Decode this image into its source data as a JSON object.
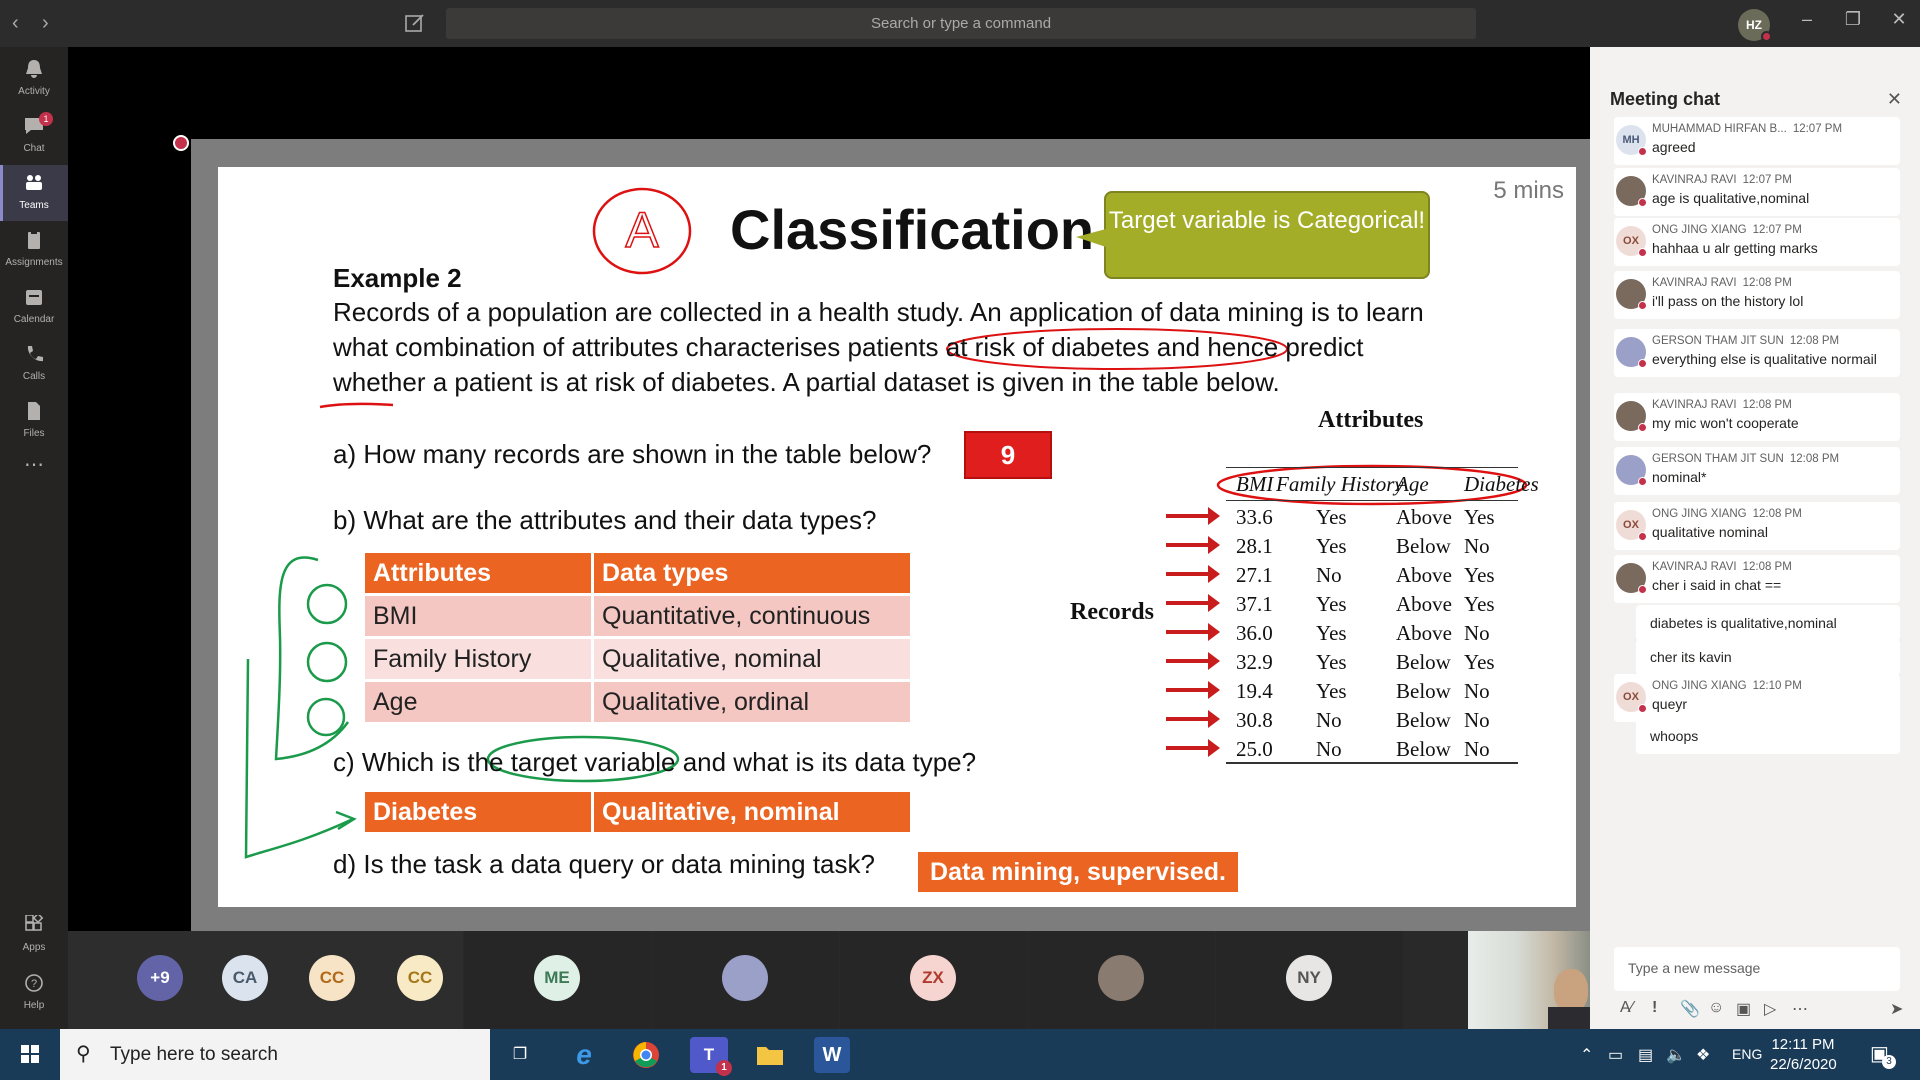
{
  "titlebar": {
    "search_placeholder": "Search or type a command",
    "user_initials": "HZ"
  },
  "rail": {
    "items": [
      {
        "label": "Activity",
        "icon": "bell-icon"
      },
      {
        "label": "Chat",
        "icon": "chat-icon",
        "badge": "1"
      },
      {
        "label": "Teams",
        "icon": "teams-icon",
        "active": true
      },
      {
        "label": "Assignments",
        "icon": "assignments-icon"
      },
      {
        "label": "Calendar",
        "icon": "calendar-icon"
      },
      {
        "label": "Calls",
        "icon": "phone-icon"
      },
      {
        "label": "Files",
        "icon": "files-icon"
      },
      {
        "label": "Apps",
        "icon": "apps-icon"
      },
      {
        "label": "Help",
        "icon": "help-icon"
      }
    ]
  },
  "slide": {
    "title": "Classification",
    "title_mark": "A",
    "timer": "5 mins",
    "callout": "Target variable is Categorical!",
    "example": "Example 2",
    "paragraph": "Records of a population are collected in a health study. An application of data mining is to learn what combination of attributes characterises patients at risk of diabetes and hence predict whether a patient is at risk of diabetes. A partial dataset is given in the table below.",
    "q_a": "a) How many records are shown in the table below?",
    "q_a_answer": "9",
    "q_b": "b) What are the attributes and their data types?",
    "types_table": {
      "headers": [
        "Attributes",
        "Data types"
      ],
      "rows": [
        [
          "BMI",
          "Quantitative, continuous"
        ],
        [
          "Family History",
          "Qualitative, nominal"
        ],
        [
          "Age",
          "Qualitative, ordinal"
        ]
      ]
    },
    "q_c": "c) Which is the target variable and what is its data type?",
    "target_row": [
      "Diabetes",
      "Qualitative, nominal"
    ],
    "q_d": "d) Is the task a data query or data mining task?",
    "q_d_answer": "Data mining, supervised.",
    "attributes_caption": "Attributes",
    "records_label": "Records",
    "records_table": {
      "headers": [
        "BMI",
        "Family History",
        "Age",
        "Diabetes"
      ],
      "rows": [
        [
          "33.6",
          "Yes",
          "Above",
          "Yes"
        ],
        [
          "28.1",
          "Yes",
          "Below",
          "No"
        ],
        [
          "27.1",
          "No",
          "Above",
          "Yes"
        ],
        [
          "37.1",
          "Yes",
          "Above",
          "Yes"
        ],
        [
          "36.0",
          "Yes",
          "Above",
          "No"
        ],
        [
          "32.9",
          "Yes",
          "Below",
          "Yes"
        ],
        [
          "19.4",
          "Yes",
          "Below",
          "No"
        ],
        [
          "30.8",
          "No",
          "Below",
          "No"
        ],
        [
          "25.0",
          "No",
          "Below",
          "No"
        ]
      ]
    }
  },
  "participants": [
    {
      "initials": "+9",
      "bg": "#6264a7",
      "fg": "#ffffff"
    },
    {
      "initials": "CA",
      "bg": "#dbe4ee",
      "fg": "#4a5a6a"
    },
    {
      "initials": "CC",
      "bg": "#f7e4c6",
      "fg": "#b06a1a"
    },
    {
      "initials": "CC",
      "bg": "#f7eac4",
      "fg": "#a4781a"
    },
    {
      "initials": "ME",
      "bg": "#dff0e6",
      "fg": "#3d7a56"
    },
    {
      "initials": "",
      "bg": "#9aa0c8",
      "fg": "#ffffff"
    },
    {
      "initials": "ZX",
      "bg": "#f6d5d0",
      "fg": "#b03a2e"
    },
    {
      "initials": "",
      "bg": "#8a7b70",
      "fg": "#ffffff"
    },
    {
      "initials": "NY",
      "bg": "#e7e6e5",
      "fg": "#555555"
    }
  ],
  "chat": {
    "title": "Meeting chat",
    "compose_placeholder": "Type a new message",
    "messages": [
      {
        "initials": "MH",
        "name": "MUHAMMAD HIRFAN B...",
        "time": "12:07 PM",
        "text": "agreed",
        "avbg": "#dde3ee",
        "avfg": "#4a5a7a"
      },
      {
        "initials": "",
        "name": "KAVINRAJ RAVI",
        "time": "12:07 PM",
        "text": "age is qualitative,nominal",
        "avbg": "#7a6a5e",
        "avfg": "#fff"
      },
      {
        "initials": "OX",
        "name": "ONG JING XIANG",
        "time": "12:07 PM",
        "text": "hahhaa u alr getting marks",
        "avbg": "#f0dcd6",
        "avfg": "#8a4a3a"
      },
      {
        "initials": "",
        "name": "KAVINRAJ RAVI",
        "time": "12:08 PM",
        "text": "i'll pass on the history lol",
        "avbg": "#7a6a5e",
        "avfg": "#fff"
      },
      {
        "initials": "",
        "name": "GERSON THAM JIT SUN",
        "time": "12:08 PM",
        "text": "everything else is qualitative normail",
        "avbg": "#9aa0c8",
        "avfg": "#fff"
      },
      {
        "initials": "",
        "name": "KAVINRAJ RAVI",
        "time": "12:08 PM",
        "text": "my mic won't cooperate",
        "avbg": "#7a6a5e",
        "avfg": "#fff"
      },
      {
        "initials": "",
        "name": "GERSON THAM JIT SUN",
        "time": "12:08 PM",
        "text": "nominal*",
        "avbg": "#9aa0c8",
        "avfg": "#fff"
      },
      {
        "initials": "OX",
        "name": "ONG JING XIANG",
        "time": "12:08 PM",
        "text": "qualitative nominal",
        "avbg": "#f0dcd6",
        "avfg": "#8a4a3a"
      },
      {
        "initials": "",
        "name": "KAVINRAJ RAVI",
        "time": "12:08 PM",
        "text": "cher i said in chat ==",
        "avbg": "#7a6a5e",
        "avfg": "#fff"
      },
      {
        "text": "diabetes is qualitative,nominal"
      },
      {
        "text": "cher its kavin"
      },
      {
        "initials": "OX",
        "name": "ONG JING XIANG",
        "time": "12:10 PM",
        "text": "queyr",
        "avbg": "#f0dcd6",
        "avfg": "#8a4a3a"
      },
      {
        "text": "whoops"
      }
    ]
  },
  "taskbar": {
    "search_placeholder": "Type here to search",
    "lang": "ENG",
    "time": "12:11 PM",
    "date": "22/6/2020",
    "teams_badge": "1",
    "notif_count": "3"
  }
}
